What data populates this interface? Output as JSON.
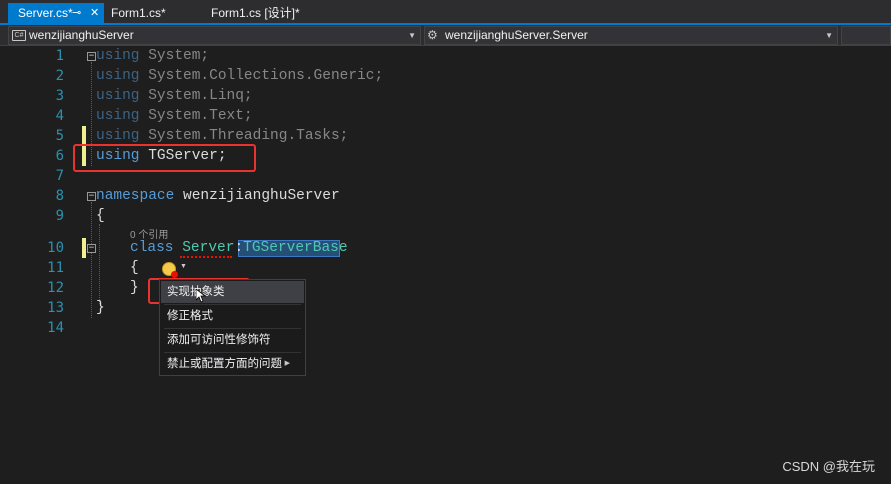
{
  "tabs": [
    {
      "label": "Server.cs*",
      "pin": "⊸",
      "close": "✕"
    },
    {
      "label": "Form1.cs*"
    },
    {
      "label": "Form1.cs [设计]*"
    }
  ],
  "nav": {
    "project": "wenzijianghuServer",
    "member": "wenzijianghuServer.Server",
    "project_icon": "C#"
  },
  "editor": {
    "line_numbers": [
      "1",
      "2",
      "3",
      "4",
      "5",
      "6",
      "7",
      "8",
      "9",
      "10",
      "11",
      "12",
      "13",
      "14"
    ],
    "lines": {
      "l1": {
        "kw": "using",
        "rest": " System;"
      },
      "l2": {
        "kw": "using",
        "rest": " System.Collections.Generic;"
      },
      "l3": {
        "kw": "using",
        "rest": " System.Linq;"
      },
      "l4": {
        "kw": "using",
        "rest": " System.Text;"
      },
      "l5": {
        "kw": "using",
        "rest": " System.Threading.Tasks;"
      },
      "l6": {
        "kw": "using",
        "rest": " TGServer;"
      },
      "l8": {
        "kw": "namespace",
        "rest": " wenzijianghuServer"
      },
      "l9": "{",
      "ref": "0 个引用",
      "l10": {
        "kw": "class",
        "name": "Server",
        "colon": ":",
        "base": "TGServerBase"
      },
      "l11": "{",
      "l12": "}",
      "l13": "}"
    }
  },
  "quick_actions": {
    "items": [
      "实现抽象类",
      "修正格式",
      "添加可访问性修饰符",
      "禁止或配置方面的问题"
    ]
  },
  "watermark": "CSDN @我在玩"
}
